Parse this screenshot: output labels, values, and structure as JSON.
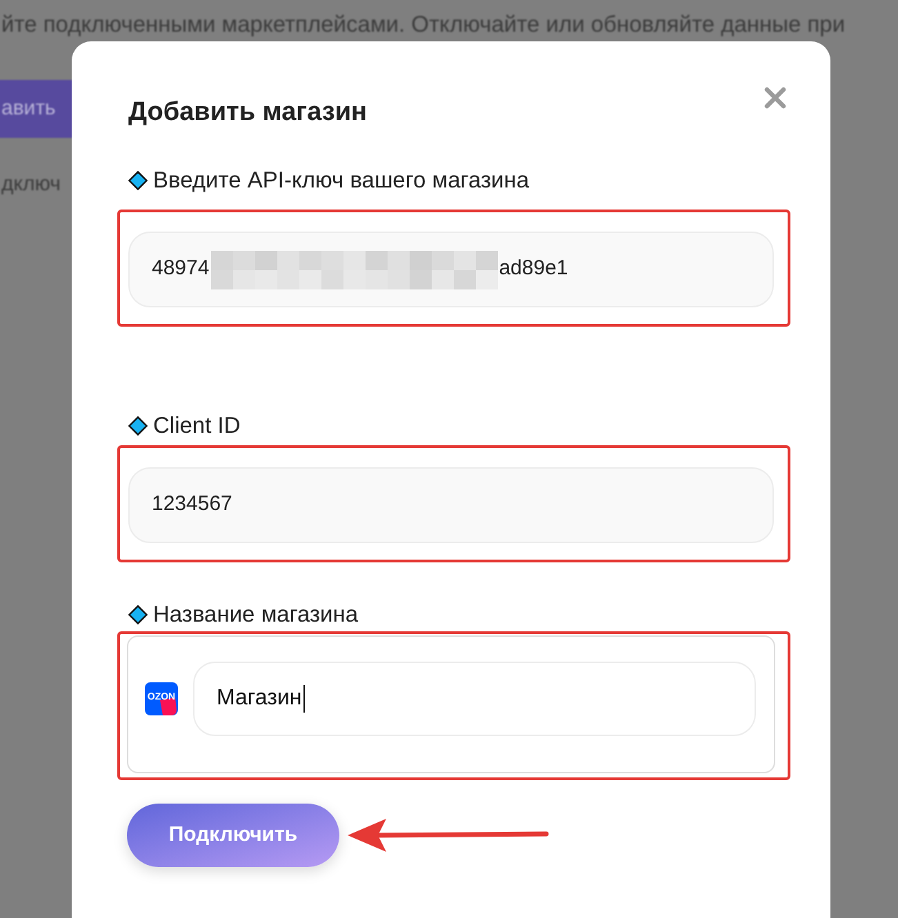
{
  "background_page": {
    "description": "йте подключенными маркетплейсами. Отключайте или обновляйте данные при",
    "button": "авить",
    "text_below": "дключ"
  },
  "dialog": {
    "title": "Добавить магазин",
    "fields": [
      {
        "kind": "text",
        "label": "Введите API-ключ вашего магазина",
        "value": "48974",
        "redacted": true,
        "value_end": "ad89e1",
        "highlighted": true
      },
      {
        "kind": "text",
        "label": "Client ID",
        "value": "1234567",
        "highlighted": true
      },
      {
        "kind": "store",
        "label": "Название магазина",
        "logo_text": "OZON",
        "value": "Магазин",
        "focused": true,
        "highlighted": true
      }
    ],
    "submit": {
      "label": "Подключить",
      "pointed_at": true
    }
  }
}
